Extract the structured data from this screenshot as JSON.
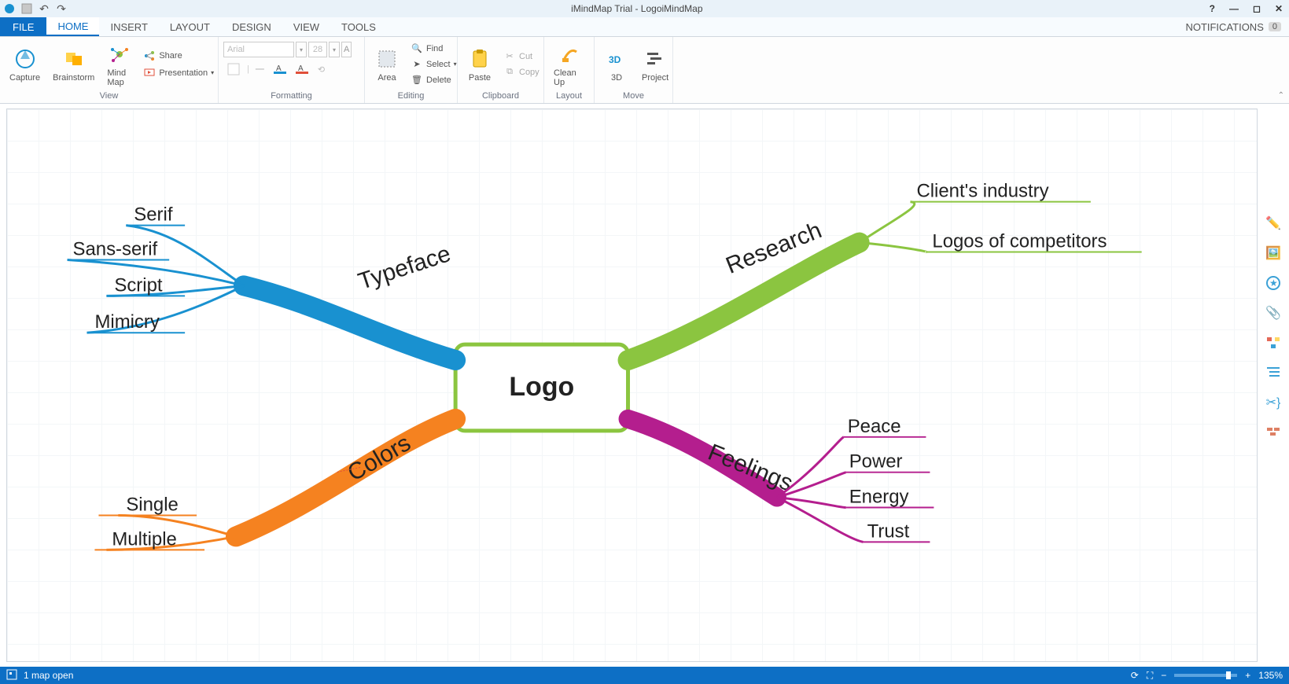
{
  "titlebar": {
    "title": "iMindMap Trial - LogoiMindMap"
  },
  "tabs": {
    "file": "FILE",
    "items": [
      "HOME",
      "INSERT",
      "LAYOUT",
      "DESIGN",
      "VIEW",
      "TOOLS"
    ],
    "active": "HOME",
    "notifications_label": "NOTIFICATIONS",
    "notifications_count": "0"
  },
  "ribbon": {
    "view": {
      "capture": "Capture",
      "brainstorm": "Brainstorm",
      "mindmap": "Mind Map",
      "presentation": "Presentation",
      "share": "Share",
      "label": "View"
    },
    "formatting": {
      "font_placeholder": "Arial",
      "size": "28",
      "label": "Formatting"
    },
    "editing": {
      "area": "Area",
      "find": "Find",
      "select": "Select",
      "delete": "Delete",
      "label": "Editing"
    },
    "clipboard": {
      "paste": "Paste",
      "cut": "Cut",
      "copy": "Copy",
      "label": "Clipboard"
    },
    "layout": {
      "cleanup": "Clean Up",
      "label": "Layout"
    },
    "move": {
      "threed": "3D",
      "project": "Project",
      "label": "Move"
    }
  },
  "mindmap": {
    "central": "Logo",
    "branches": {
      "typeface": {
        "label": "Typeface",
        "color": "#1991d0",
        "children": [
          "Serif",
          "Sans-serif",
          "Script",
          "Mimicry"
        ]
      },
      "research": {
        "label": "Research",
        "color": "#8bc540",
        "children": [
          "Client's industry",
          "Logos of competitors"
        ]
      },
      "colors": {
        "label": "Colors",
        "color": "#f58220",
        "children": [
          "Single",
          "Multiple"
        ]
      },
      "feelings": {
        "label": "Feelings",
        "color": "#b41e8e",
        "children": [
          "Peace",
          "Power",
          "Energy",
          "Trust"
        ]
      }
    }
  },
  "status": {
    "maps_open": "1 map open",
    "zoom": "135%"
  }
}
